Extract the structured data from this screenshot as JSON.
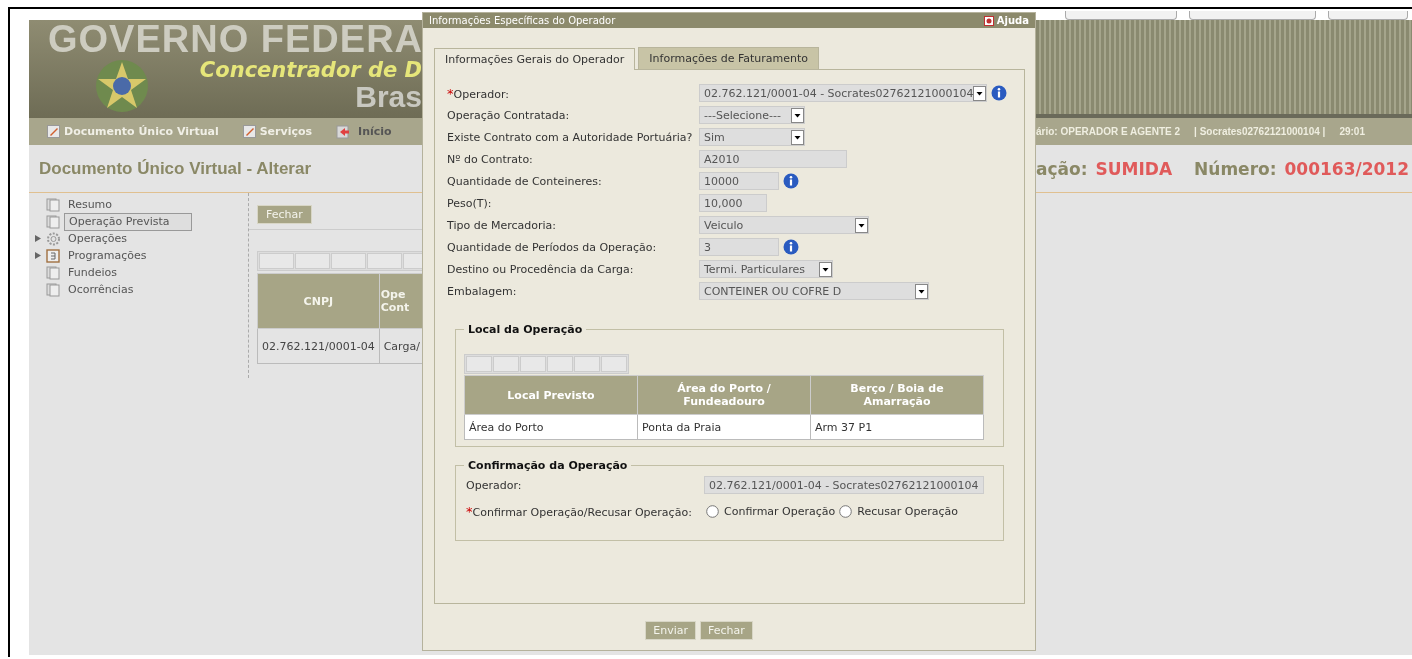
{
  "banner": {
    "title": "GOVERNO FEDERA",
    "subtitle": "Concentrador de D",
    "subtitle_2": "Bras"
  },
  "nav": {
    "items": [
      {
        "label": "Documento Único Virtual",
        "kind": "edit"
      },
      {
        "label": "Serviços",
        "kind": "edit"
      },
      {
        "label": "Início",
        "kind": "exit"
      }
    ],
    "user": "ário: OPERADOR E AGENTE 2",
    "account": "| Socrates02762121000104 |",
    "timer": "29:01"
  },
  "page": {
    "title": "Documento Único Virtual - Alterar",
    "status_label": "ação:",
    "status": "SUMIDA",
    "number_label": "Número:",
    "number": "000163/2012"
  },
  "tree": [
    {
      "label": "Resumo",
      "kind": "doc",
      "selected": false
    },
    {
      "label": "Operação Prevista",
      "kind": "doc",
      "selected": true
    },
    {
      "label": "Operações",
      "kind": "gear",
      "selected": false,
      "expanded": false
    },
    {
      "label": "Programações",
      "kind": "calendar",
      "selected": false,
      "expanded": false
    },
    {
      "label": "Fundeios",
      "kind": "doc",
      "selected": false
    },
    {
      "label": "Ocorrências",
      "kind": "doc",
      "selected": false
    }
  ],
  "content": {
    "close_button": "Fechar",
    "columns": [
      "CNPJ",
      "Ope Cont"
    ],
    "rows": [
      [
        "02.762.121/0001-04",
        "Carga/"
      ]
    ]
  },
  "dialog": {
    "title": "Informações Específicas do Operador",
    "help": "Ajuda",
    "tabs": [
      {
        "label": "Informações Gerais do Operador",
        "selected": true
      },
      {
        "label": "Informações de Faturamento",
        "selected": false
      }
    ],
    "fields": [
      {
        "label": "Operador:",
        "required_mark": "*",
        "kind": "select",
        "value": "02.762.121/0001-04 - Socrates02762121000104",
        "info": true
      },
      {
        "label": "Operação Contratada:",
        "kind": "select",
        "value": "---Selecione---",
        "info": false
      },
      {
        "label": "Existe Contrato com a Autoridade Portuária?",
        "kind": "select",
        "value": "Sim",
        "info": false
      },
      {
        "label": "Nº do Contrato:",
        "kind": "input",
        "value": "A2010",
        "info": false
      },
      {
        "label": "Quantidade de Conteineres:",
        "kind": "input",
        "value": "10000",
        "info": true
      },
      {
        "label": "Peso(T):",
        "kind": "input",
        "value": "10,000",
        "info": false
      },
      {
        "label": "Tipo de Mercadoria:",
        "kind": "select",
        "value": "Veiculo",
        "info": false
      },
      {
        "label": "Quantidade de Períodos da Operação:",
        "kind": "input",
        "value": "3",
        "info": true
      },
      {
        "label": "Destino ou Procedência da Carga:",
        "kind": "select",
        "value": "Termi. Particulares",
        "info": false
      },
      {
        "label": "Embalagem:",
        "kind": "select",
        "value": "CONTEINER OU COFRE D",
        "info": false
      }
    ],
    "local": {
      "legend": "Local da Operação",
      "columns": [
        "Local Previsto",
        "Área do Porto / Fundeadouro",
        "Berço / Boia de Amarração"
      ],
      "rows": [
        [
          "Área do Porto",
          "Ponta da Praia",
          "Arm 37 P1"
        ]
      ]
    },
    "confirm": {
      "legend": "Confirmação da Operação",
      "operator_label": "Operador:",
      "operator_value": "02.762.121/0001-04 - Socrates02762121000104",
      "question": "Confirmar Operação/Recusar Operação:",
      "required_mark": "*",
      "options": [
        {
          "label": "Confirmar Operação",
          "selected": false
        },
        {
          "label": "Recusar Operação",
          "selected": false
        }
      ]
    },
    "buttons": [
      "Enviar",
      "Fechar"
    ]
  }
}
